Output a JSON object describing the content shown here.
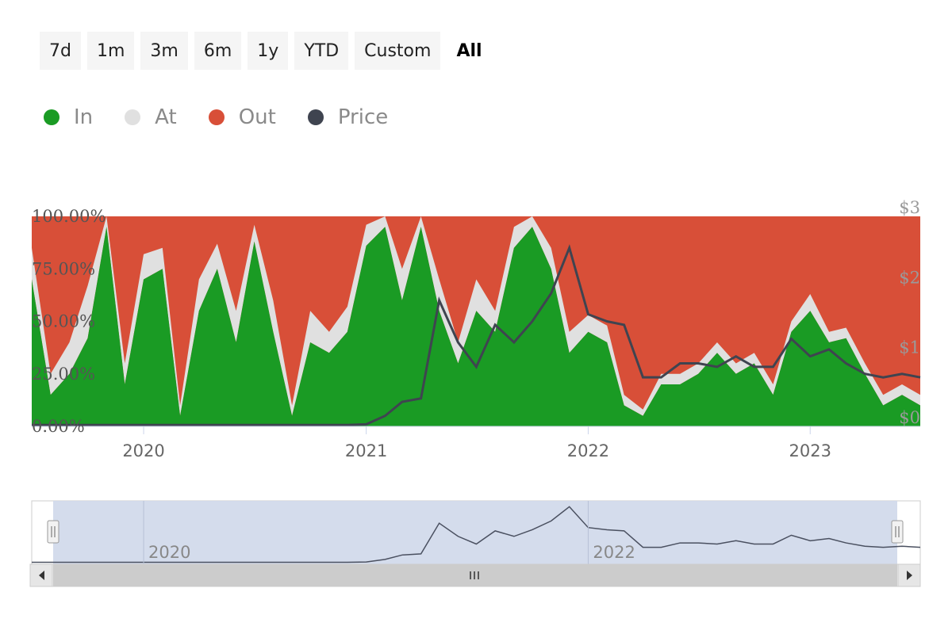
{
  "range_selector": {
    "buttons": [
      "7d",
      "1m",
      "3m",
      "6m",
      "1y",
      "YTD",
      "Custom"
    ],
    "active_label": "All"
  },
  "legend": [
    {
      "label": "In",
      "color": "#1a9b24"
    },
    {
      "label": "At",
      "color": "#e0e0e0"
    },
    {
      "label": "Out",
      "color": "#d84f38"
    },
    {
      "label": "Price",
      "color": "#3f4450"
    }
  ],
  "chart_data": {
    "type": "area",
    "stacked_percent": true,
    "x_ticks": [
      "2020",
      "2021",
      "2022",
      "2023"
    ],
    "y_ticks": [
      "0.00%",
      "25.00%",
      "50.00%",
      "75.00%",
      "100.00%"
    ],
    "y2_ticks": [
      "$0",
      "$1",
      "$2",
      "$3"
    ],
    "ylim": [
      0,
      100
    ],
    "y2lim": [
      0,
      3
    ],
    "x": [
      "2019-07",
      "2019-08",
      "2019-09",
      "2019-10",
      "2019-11",
      "2019-12",
      "2020-01",
      "2020-02",
      "2020-03",
      "2020-04",
      "2020-05",
      "2020-06",
      "2020-07",
      "2020-08",
      "2020-09",
      "2020-10",
      "2020-11",
      "2020-12",
      "2021-01",
      "2021-02",
      "2021-03",
      "2021-04",
      "2021-05",
      "2021-06",
      "2021-07",
      "2021-08",
      "2021-09",
      "2021-10",
      "2021-11",
      "2021-12",
      "2022-01",
      "2022-02",
      "2022-03",
      "2022-04",
      "2022-05",
      "2022-06",
      "2022-07",
      "2022-08",
      "2022-09",
      "2022-10",
      "2022-11",
      "2022-12",
      "2023-01",
      "2023-02",
      "2023-03",
      "2023-04",
      "2023-05",
      "2023-06",
      "2023-07"
    ],
    "series": [
      {
        "name": "In",
        "values": [
          70,
          15,
          25,
          42,
          95,
          20,
          70,
          75,
          5,
          55,
          75,
          40,
          88,
          45,
          5,
          40,
          35,
          45,
          86,
          95,
          60,
          95,
          55,
          30,
          55,
          45,
          85,
          95,
          75,
          35,
          45,
          40,
          10,
          5,
          20,
          20,
          25,
          35,
          25,
          30,
          15,
          45,
          55,
          40,
          42,
          25,
          10,
          15,
          10
        ]
      },
      {
        "name": "At",
        "values": [
          15,
          10,
          15,
          25,
          5,
          10,
          12,
          10,
          5,
          15,
          12,
          15,
          8,
          15,
          5,
          15,
          10,
          12,
          10,
          5,
          15,
          5,
          15,
          10,
          15,
          10,
          10,
          5,
          10,
          10,
          8,
          8,
          5,
          3,
          5,
          5,
          5,
          5,
          5,
          5,
          5,
          5,
          8,
          5,
          5,
          5,
          5,
          5,
          5
        ]
      },
      {
        "name": "Price",
        "values": [
          0.02,
          0.02,
          0.02,
          0.02,
          0.02,
          0.02,
          0.02,
          0.02,
          0.02,
          0.02,
          0.02,
          0.02,
          0.02,
          0.02,
          0.02,
          0.02,
          0.02,
          0.02,
          0.03,
          0.15,
          0.35,
          0.4,
          1.8,
          1.2,
          0.85,
          1.45,
          1.2,
          1.5,
          1.9,
          2.55,
          1.6,
          1.5,
          1.45,
          0.7,
          0.7,
          0.9,
          0.9,
          0.85,
          1.0,
          0.85,
          0.85,
          1.25,
          1.0,
          1.1,
          0.9,
          0.75,
          0.7,
          0.75,
          0.7
        ]
      }
    ]
  }
}
